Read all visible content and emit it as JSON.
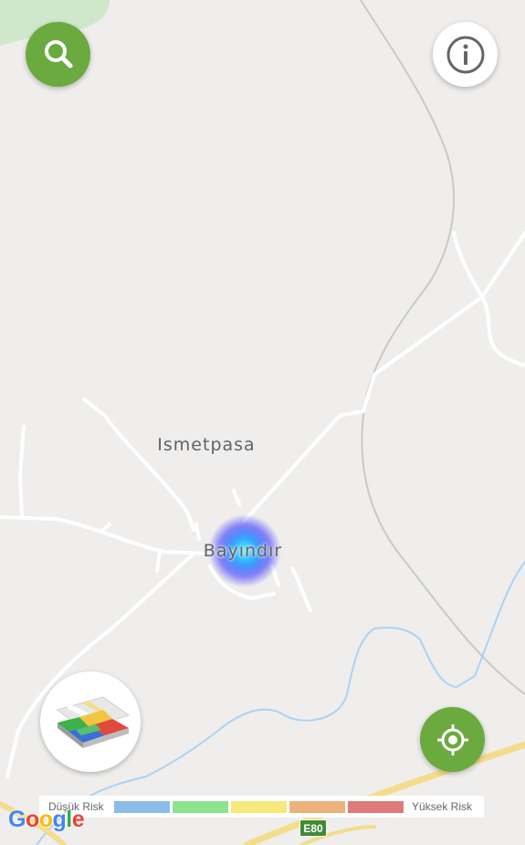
{
  "map": {
    "place_labels": {
      "ismetpasa": "Ismetpasa",
      "bayindir": "Bayındır"
    },
    "road_shield": "E80",
    "attribution": "Google"
  },
  "controls": {
    "search_icon": "search-icon",
    "info_icon": "info-icon",
    "locate_icon": "my-location-icon",
    "layers_icon": "map-layers-thumbnail-icon"
  },
  "legend": {
    "low_label": "Düşük Risk",
    "high_label": "Yüksek Risk",
    "colors": [
      "#8bbde8",
      "#8ee38f",
      "#f7e87c",
      "#eeb37d",
      "#e07a78"
    ]
  },
  "colors": {
    "accent_green": "#6aaa3f",
    "map_background": "#efeeec",
    "water": "#aad3f2",
    "highway": "#f3dd8a"
  }
}
